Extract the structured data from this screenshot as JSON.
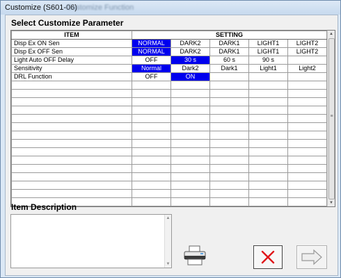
{
  "window": {
    "title": "Customize (S601-06)",
    "title_blurred": "Customize Function"
  },
  "parameters": {
    "heading": "Select Customize Parameter",
    "columns": {
      "item": "ITEM",
      "setting": "SETTING"
    },
    "rows": [
      {
        "item": "Disp Ex ON Sen",
        "options": [
          "NORMAL",
          "DARK2",
          "DARK1",
          "LIGHT1",
          "LIGHT2"
        ],
        "selected": 0
      },
      {
        "item": "Disp Ex OFF Sen",
        "options": [
          "NORMAL",
          "DARK2",
          "DARK1",
          "LIGHT1",
          "LIGHT2"
        ],
        "selected": 0
      },
      {
        "item": "Light Auto OFF Delay",
        "options": [
          "OFF",
          "30 s",
          "60 s",
          "90 s",
          ""
        ],
        "selected": 1
      },
      {
        "item": "Sensitivity",
        "options": [
          "Normal",
          "Dark2",
          "Dark1",
          "Light1",
          "Light2"
        ],
        "selected": 0
      },
      {
        "item": "DRL Function",
        "options": [
          "OFF",
          "ON",
          "",
          "",
          ""
        ],
        "selected": 1
      }
    ]
  },
  "description": {
    "heading": "Item Description",
    "text": ""
  },
  "icons": {
    "print": "printer-icon",
    "cancel": "red-x-icon",
    "next": "right-arrow-icon"
  },
  "colors": {
    "selected_bg": "#0000ee",
    "selected_fg": "#ffffff",
    "cancel_x": "#e0161b"
  }
}
